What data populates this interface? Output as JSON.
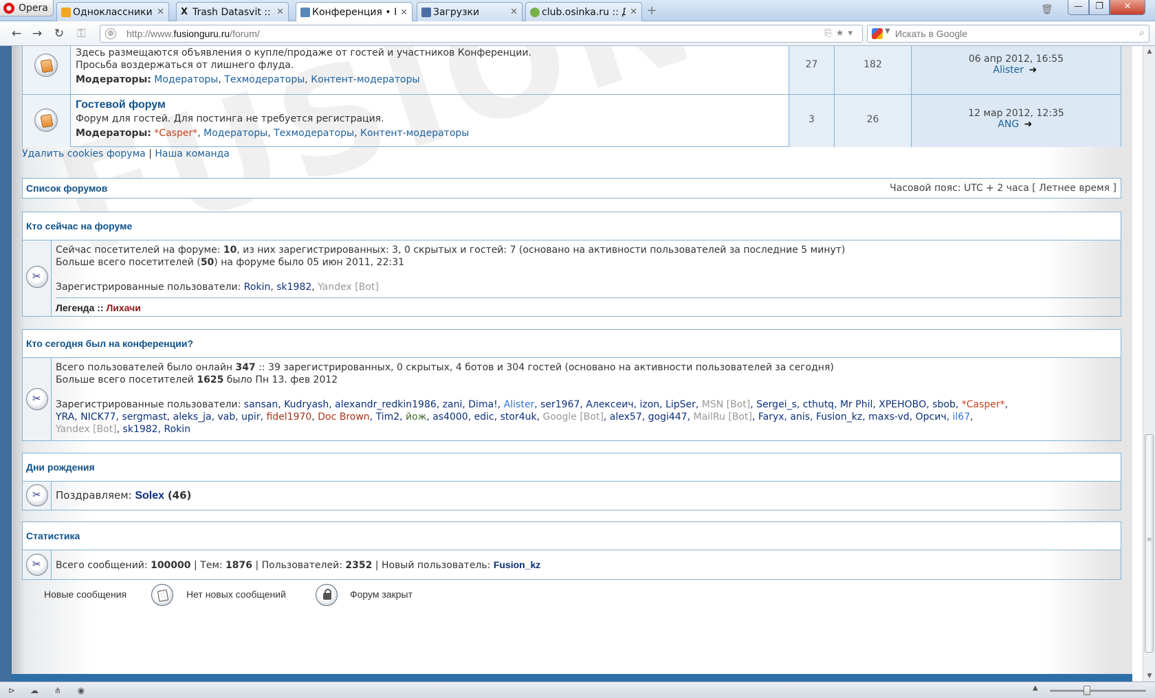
{
  "browser": {
    "menu_label": "Opera",
    "tabs": [
      {
        "title": "Одноклассники",
        "favicon_color": "#f5a623"
      },
      {
        "title": "Trash Datasvit :: Д...",
        "favicon_color": "#222222"
      },
      {
        "title": "Конференция • F...",
        "favicon_color": "#5a86b8"
      },
      {
        "title": "Загрузки",
        "favicon_color": "#4a6fa5"
      },
      {
        "title": "club.osinka.ru :: До...",
        "favicon_color": "#7ab04a"
      }
    ],
    "url_prefix": "http://www.",
    "url_domain": "fusionguru.ru",
    "url_path": "/forum/",
    "search_placeholder": "Искать в Google"
  },
  "forums": [
    {
      "title": "",
      "desc_lines": [
        "Здесь размещаются объявления о купле/продаже от гостей и участников Конференции.",
        "Просьба воздержаться от лишнего флуда."
      ],
      "mod_label": "Модераторы:",
      "moderators": [
        "Модераторы",
        "Техмодераторы",
        "Контент-модераторы"
      ],
      "topics": "27",
      "posts": "182",
      "last_date": "06 апр 2012, 16:55",
      "last_user": "Alister"
    },
    {
      "title": "Гостевой форум",
      "desc_lines": [
        "Форум для гостей. Для постинга не требуется регистрация."
      ],
      "mod_label": "Модераторы:",
      "moderators_special": "*Casper*",
      "moderators": [
        "Модераторы",
        "Техмодераторы",
        "Контент-модераторы"
      ],
      "topics": "3",
      "posts": "26",
      "last_date": "12 мар 2012, 12:35",
      "last_user": "ANG"
    }
  ],
  "links": {
    "delete_cookies": "Удалить cookies форума",
    "separator": "|",
    "team": "Наша команда"
  },
  "forum_list": {
    "title": "Список форумов",
    "timezone": "Часовой пояс: UTC + 2 часа [ Летнее время ]"
  },
  "online": {
    "title": "Кто сейчас на форуме",
    "line1_pre": "Сейчас посетителей на форуме: ",
    "line1_total": "10",
    "line1_post": ", из них зарегистрированных: 3, 0 скрытых и гостей: 7 (основано на активности пользователей за последние 5 минут)",
    "line2_pre": "Больше всего посетителей (",
    "line2_max": "50",
    "line2_post": ") на форуме было 05 июн 2011, 22:31",
    "reg_label": "Зарегистрированные пользователи: ",
    "users": [
      "Rokin",
      "sk1982"
    ],
    "bot": "Yandex [Bot]",
    "legend_label": "Легенда :: ",
    "legend_group": "Лихачи"
  },
  "today": {
    "title": "Кто сегодня был на конференции?",
    "line1_pre": "Всего пользователей было онлайн ",
    "line1_total": "347",
    "line1_post": " :: 39 зарегистрированных, 0 скрытых, 4 ботов и 304 гостей (основано на активности пользователей за сегодня)",
    "line2_pre": "Больше всего посетителей ",
    "line2_max": "1625",
    "line2_post": " было Пн 13. фев 2012",
    "reg_label": "Зарегистрированные пользователи: ",
    "users_line1": "sansan, Kudryash, alexandr_redkin1986, zani, Dima!, ",
    "u_alister": "Alister",
    "users_line1b": ", ser1967, Алексеич, izon, LipSer, ",
    "u_msn": "MSN [Bot]",
    "users_line1c": ", Sergei_s, cthutq, Mr Phil, ХРЕНОВО, sbob, ",
    "u_casper": "*Casper*",
    "users_line2a": "YRA, NICK77, sergmast, aleks_ja, vab, upir, ",
    "u_fidel": "fidel1970",
    "u_doc": "Doc Brown",
    "users_line2b": ", Tim2, ",
    "u_yozh": "йож",
    "users_line2c": ", as4000, edic, stor4uk, ",
    "u_google": "Google [Bot]",
    "users_line2d": ", alex57, gogi447, ",
    "u_mailru": "MailRu [Bot]",
    "users_line2e": ", Faryx, anis, Fusion_kz, maxs-vd, Орсич, ",
    "u_il67": "il67",
    "u_yandex": "Yandex [Bot]",
    "users_line3": ", sk1982, Rokin"
  },
  "birthdays": {
    "title": "Дни рождения",
    "congrats": "Поздравляем: ",
    "user": "Solex",
    "age": "(46)"
  },
  "stats": {
    "title": "Статистика",
    "posts_label": "Всего сообщений: ",
    "posts": "100000",
    "topics_label": " | Тем: ",
    "topics": "1876",
    "users_label": " | Пользователей: ",
    "users": "2352",
    "newuser_label": " | Новый пользователь: ",
    "newuser": "Fusion_kz"
  },
  "legend": {
    "new_posts": "Новые сообщения",
    "no_new_posts": "Нет новых сообщений",
    "locked": "Форум закрыт"
  },
  "watermark": "FUSIONGURU.RU"
}
